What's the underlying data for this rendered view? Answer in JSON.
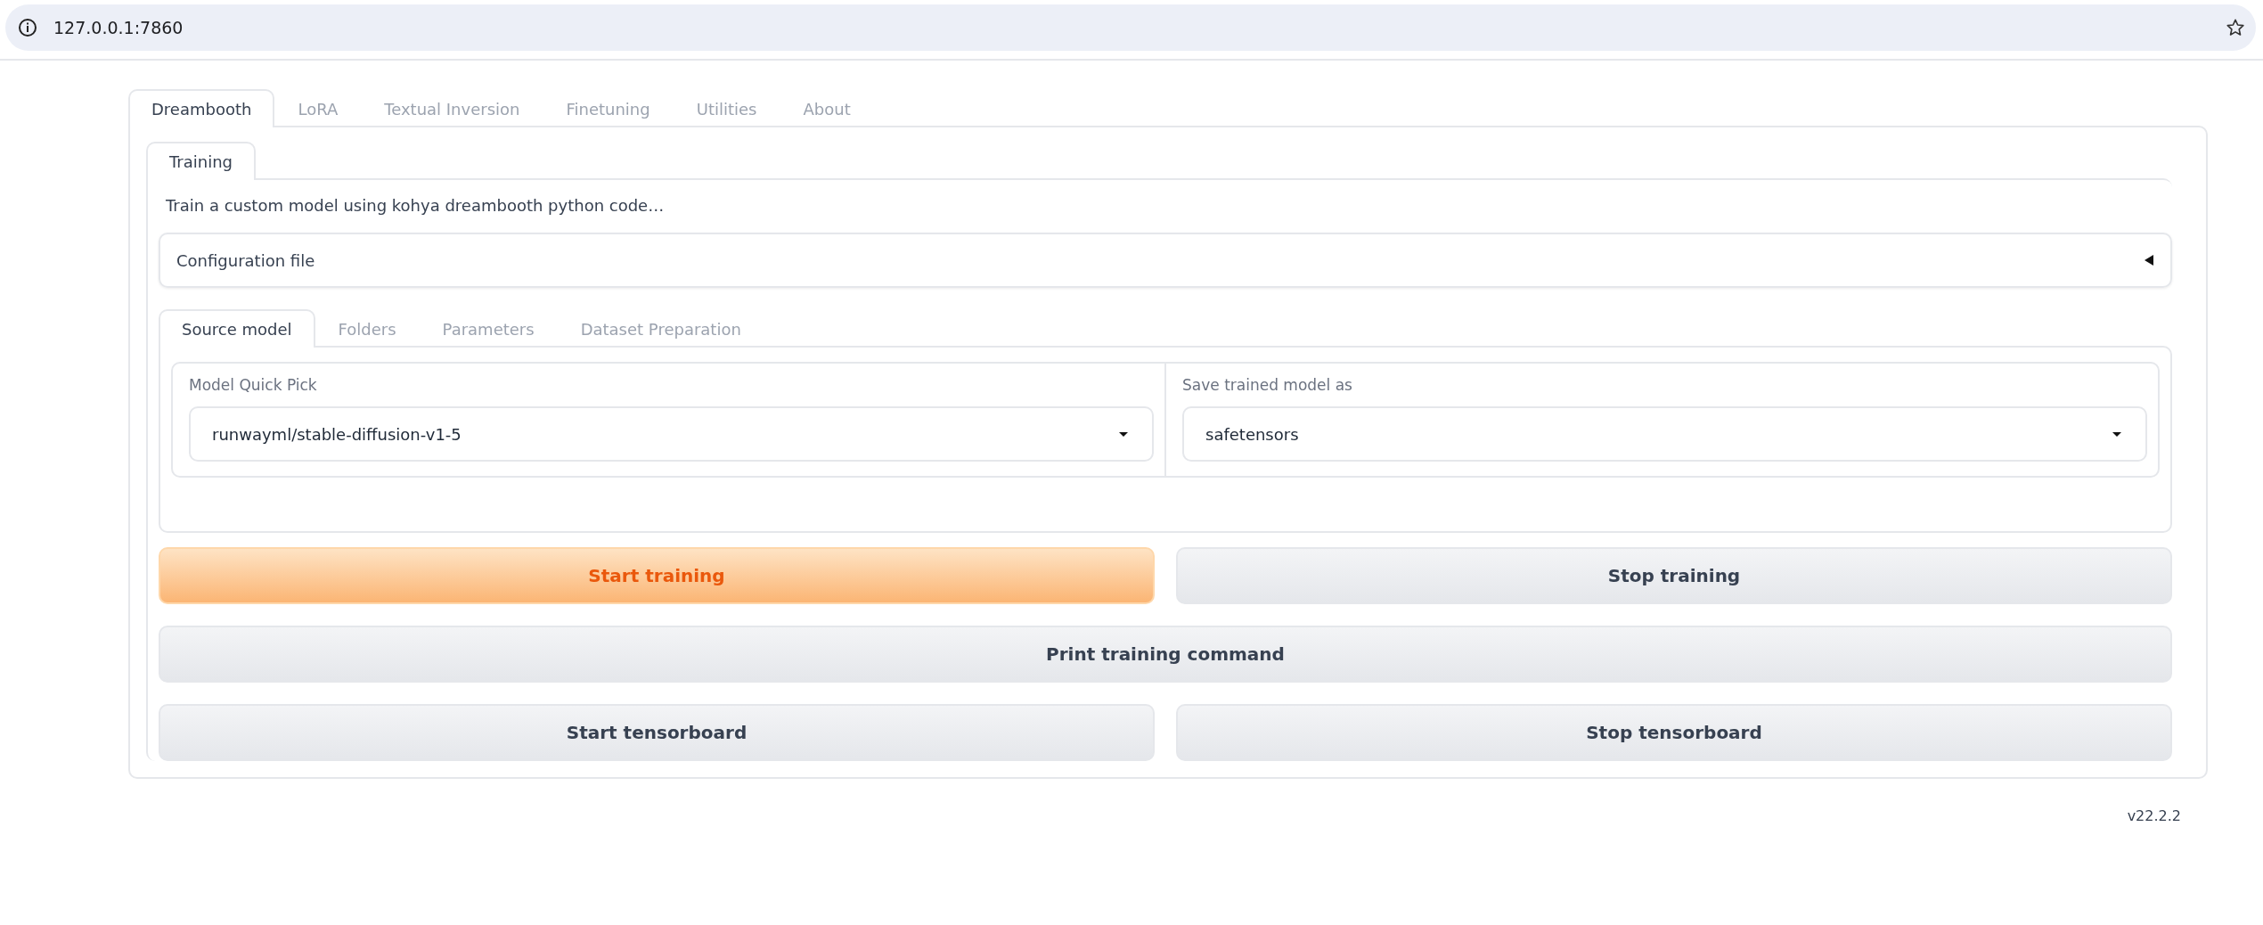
{
  "browser": {
    "url": "127.0.0.1:7860"
  },
  "tabs": [
    {
      "label": "Dreambooth",
      "selected": true
    },
    {
      "label": "LoRA",
      "selected": false
    },
    {
      "label": "Textual Inversion",
      "selected": false
    },
    {
      "label": "Finetuning",
      "selected": false
    },
    {
      "label": "Utilities",
      "selected": false
    },
    {
      "label": "About",
      "selected": false
    }
  ],
  "subtabs": [
    {
      "label": "Training",
      "selected": true
    }
  ],
  "description": "Train a custom model using kohya dreambooth python code…",
  "config_accordion": {
    "label": "Configuration file",
    "expanded": false
  },
  "section_tabs": [
    {
      "label": "Source model",
      "selected": true
    },
    {
      "label": "Folders",
      "selected": false
    },
    {
      "label": "Parameters",
      "selected": false
    },
    {
      "label": "Dataset Preparation",
      "selected": false
    }
  ],
  "dropdowns": [
    {
      "label": "Model Quick Pick",
      "value": "runwayml/stable-diffusion-v1-5"
    },
    {
      "label": "Save trained model as",
      "value": "safetensors"
    }
  ],
  "button_rows": [
    [
      {
        "label": "Start training",
        "kind": "primary"
      },
      {
        "label": "Stop training",
        "kind": "secondary"
      }
    ],
    [
      {
        "label": "Print training command",
        "kind": "secondary"
      }
    ],
    [
      {
        "label": "Start tensorboard",
        "kind": "secondary"
      },
      {
        "label": "Stop tensorboard",
        "kind": "secondary"
      }
    ]
  ],
  "footer": {
    "version": "v22.2.2"
  }
}
